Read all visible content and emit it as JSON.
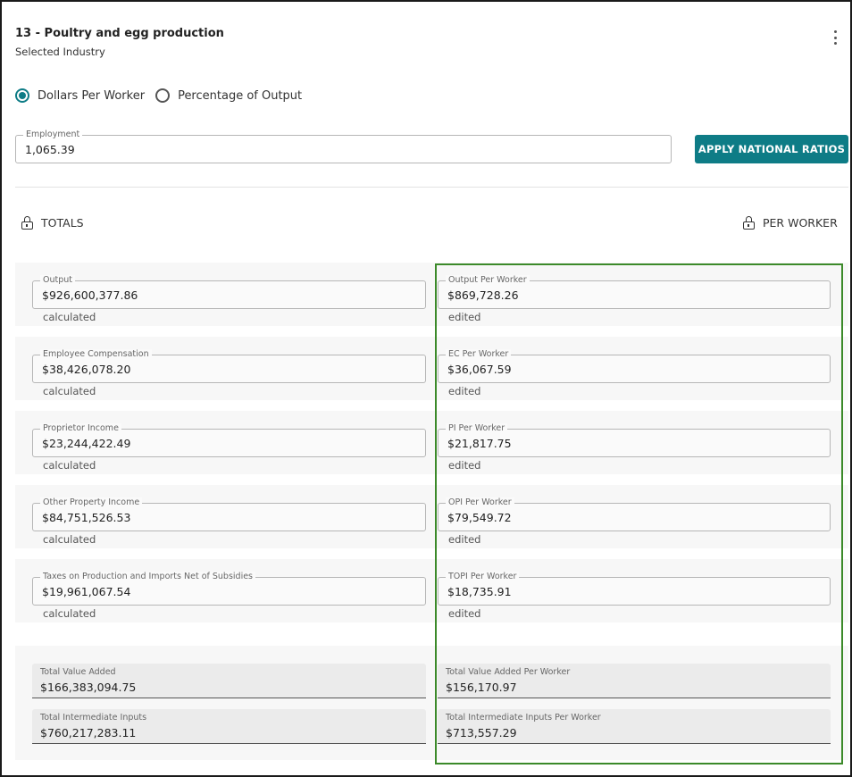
{
  "header": {
    "title": "13 - Poultry and egg production",
    "subtitle": "Selected Industry"
  },
  "mode": {
    "options": [
      {
        "label": "Dollars Per Worker",
        "selected": true
      },
      {
        "label": "Percentage of Output",
        "selected": false
      }
    ]
  },
  "employment": {
    "label": "Employment",
    "value": "1,065.39"
  },
  "apply_button": "APPLY NATIONAL RATIOS",
  "totals_header": "TOTALS",
  "per_worker_header": "PER WORKER",
  "rows": [
    {
      "total_label": "Output",
      "total_value": "$926,600,377.86",
      "total_note": "calculated",
      "pw_label": "Output Per Worker",
      "pw_value": "$869,728.26",
      "pw_note": "edited"
    },
    {
      "total_label": "Employee Compensation",
      "total_value": "$38,426,078.20",
      "total_note": "calculated",
      "pw_label": "EC Per Worker",
      "pw_value": "$36,067.59",
      "pw_note": "edited"
    },
    {
      "total_label": "Proprietor Income",
      "total_value": "$23,244,422.49",
      "total_note": "calculated",
      "pw_label": "PI Per Worker",
      "pw_value": "$21,817.75",
      "pw_note": "edited"
    },
    {
      "total_label": "Other Property Income",
      "total_value": "$84,751,526.53",
      "total_note": "calculated",
      "pw_label": "OPI Per Worker",
      "pw_value": "$79,549.72",
      "pw_note": "edited"
    },
    {
      "total_label": "Taxes on Production and Imports Net of Subsidies",
      "total_value": "$19,961,067.54",
      "total_note": "calculated",
      "pw_label": "TOPI Per Worker",
      "pw_value": "$18,735.91",
      "pw_note": "edited"
    }
  ],
  "summary": [
    {
      "total_label": "Total Value Added",
      "total_value": "$166,383,094.75",
      "pw_label": "Total Value Added Per Worker",
      "pw_value": "$156,170.97"
    },
    {
      "total_label": "Total Intermediate Inputs",
      "total_value": "$760,217,283.11",
      "pw_label": "Total Intermediate Inputs Per Worker",
      "pw_value": "$713,557.29"
    }
  ],
  "colors": {
    "accent": "#0e7c86",
    "highlight_border": "#3c8a2a"
  }
}
